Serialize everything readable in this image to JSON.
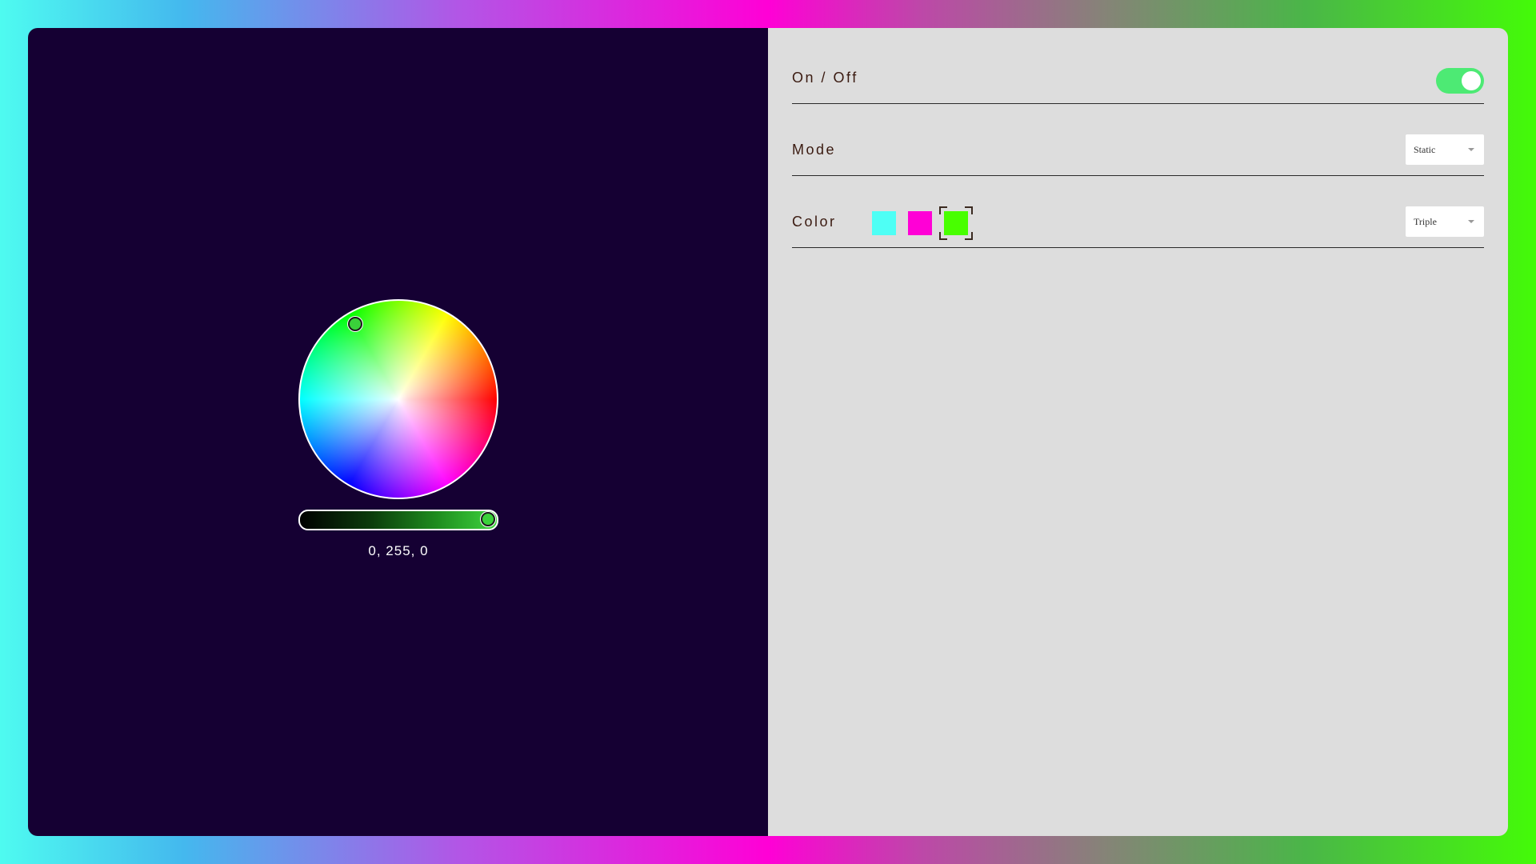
{
  "colors": {
    "panel_left_bg": "#150033",
    "panel_right_bg": "#dddddd",
    "toggle_on": "#4dea74"
  },
  "picker": {
    "rgb_readout": "0, 255, 0",
    "brightness_level": 1.0
  },
  "settings": {
    "power": {
      "label": "On / Off",
      "on": true
    },
    "mode": {
      "label": "Mode",
      "selected": "Static"
    },
    "color": {
      "label": "Color",
      "swatches": [
        {
          "color": "#4efff5",
          "icon": "color-swatch"
        },
        {
          "color": "#ff00d6",
          "icon": "color-swatch"
        },
        {
          "color": "#48ff00",
          "icon": "color-swatch",
          "selected": true
        }
      ],
      "selected": "Triple"
    }
  }
}
